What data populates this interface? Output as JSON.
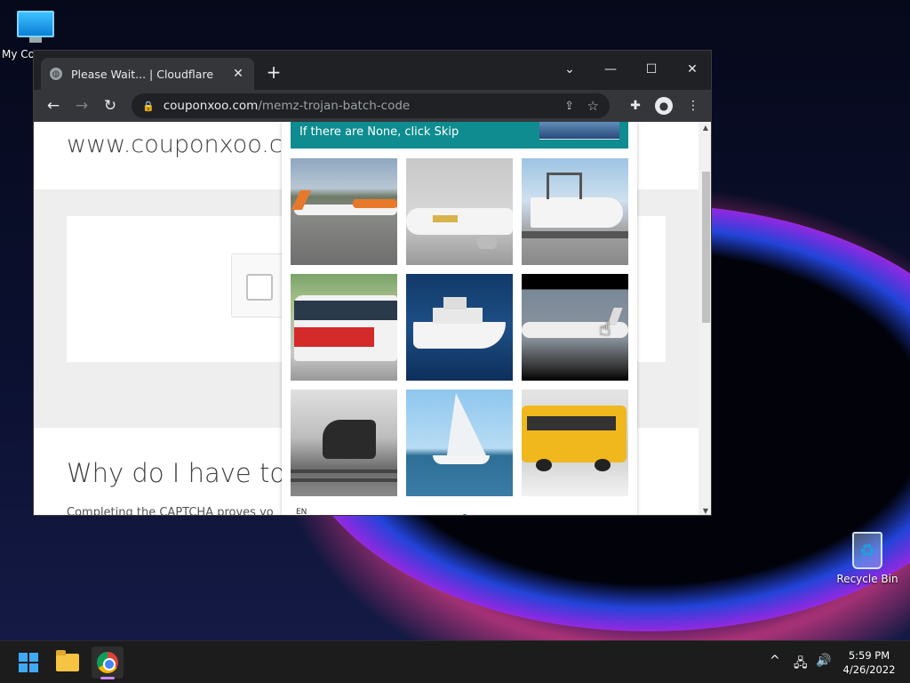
{
  "desktop": {
    "icons": [
      {
        "label": "My Co",
        "icon": "monitor-icon"
      },
      {
        "label": "Recycle Bin",
        "icon": "recycle-bin-icon"
      }
    ]
  },
  "browser": {
    "tab": {
      "title": "Please Wait... | Cloudflare",
      "close": "✕",
      "favicon": "globe-icon"
    },
    "new_tab": "+",
    "window_controls": {
      "tab_search": "⌄",
      "minimize": "—",
      "maximize": "☐",
      "close": "✕"
    },
    "nav": {
      "back": "←",
      "forward": "→",
      "reload": "↻"
    },
    "address": {
      "domain": "couponxoo.com",
      "path": "/memz-trojan-batch-code"
    },
    "toolbar_icons": [
      "share-icon",
      "star-icon",
      "extensions-icon",
      "profile-icon",
      "menu-icon"
    ]
  },
  "page": {
    "heading": "www.couponxoo.co",
    "why_heading": "Why do I have to c",
    "complete_text": "Completing the CAPTCHA proves yo"
  },
  "captcha": {
    "instruction": "If there are None, click Skip",
    "language": "EN",
    "tiles": [
      {
        "name": "tile-airplane-runway",
        "subject": "airplane"
      },
      {
        "name": "tile-airplane-white",
        "subject": "airplane"
      },
      {
        "name": "tile-boat-trailer",
        "subject": "boat"
      },
      {
        "name": "tile-bus-red",
        "subject": "bus"
      },
      {
        "name": "tile-yacht",
        "subject": "boat"
      },
      {
        "name": "tile-airplane-dark",
        "subject": "airplane"
      },
      {
        "name": "tile-train",
        "subject": "train"
      },
      {
        "name": "tile-sailboat",
        "subject": "boat"
      },
      {
        "name": "tile-school-bus",
        "subject": "bus"
      }
    ]
  },
  "taskbar": {
    "apps": [
      "start-icon",
      "file-explorer-icon",
      "chrome-icon"
    ],
    "tray": {
      "chevron": "^",
      "network": "network-icon",
      "volume": "volume-icon"
    },
    "time": "5:59 PM",
    "date": "4/26/2022"
  }
}
